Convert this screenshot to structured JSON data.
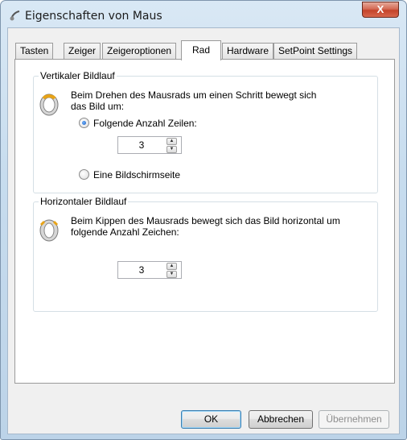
{
  "window": {
    "title": "Eigenschaften von Maus",
    "close_label": "X"
  },
  "tabs": [
    {
      "label": "Tasten"
    },
    {
      "label": "Zeiger"
    },
    {
      "label": "Zeigeroptionen"
    },
    {
      "label": "Rad",
      "active": true
    },
    {
      "label": "Hardware"
    },
    {
      "label": "SetPoint Settings"
    }
  ],
  "vertical": {
    "group_title": "Vertikaler Bildlauf",
    "description": "Beim Drehen des Mausrads um einen Schritt bewegt sich das Bild um:",
    "option_lines": "Folgende Anzahl Zeilen:",
    "lines_value": "3",
    "option_screen": "Eine Bildschirmseite",
    "selected": "lines"
  },
  "horizontal": {
    "group_title": "Horizontaler Bildlauf",
    "description": "Beim Kippen des Mausrads bewegt sich das Bild horizontal um folgende Anzahl Zeichen:",
    "chars_value": "3"
  },
  "buttons": {
    "ok": "OK",
    "cancel": "Abbrechen",
    "apply": "Übernehmen"
  }
}
